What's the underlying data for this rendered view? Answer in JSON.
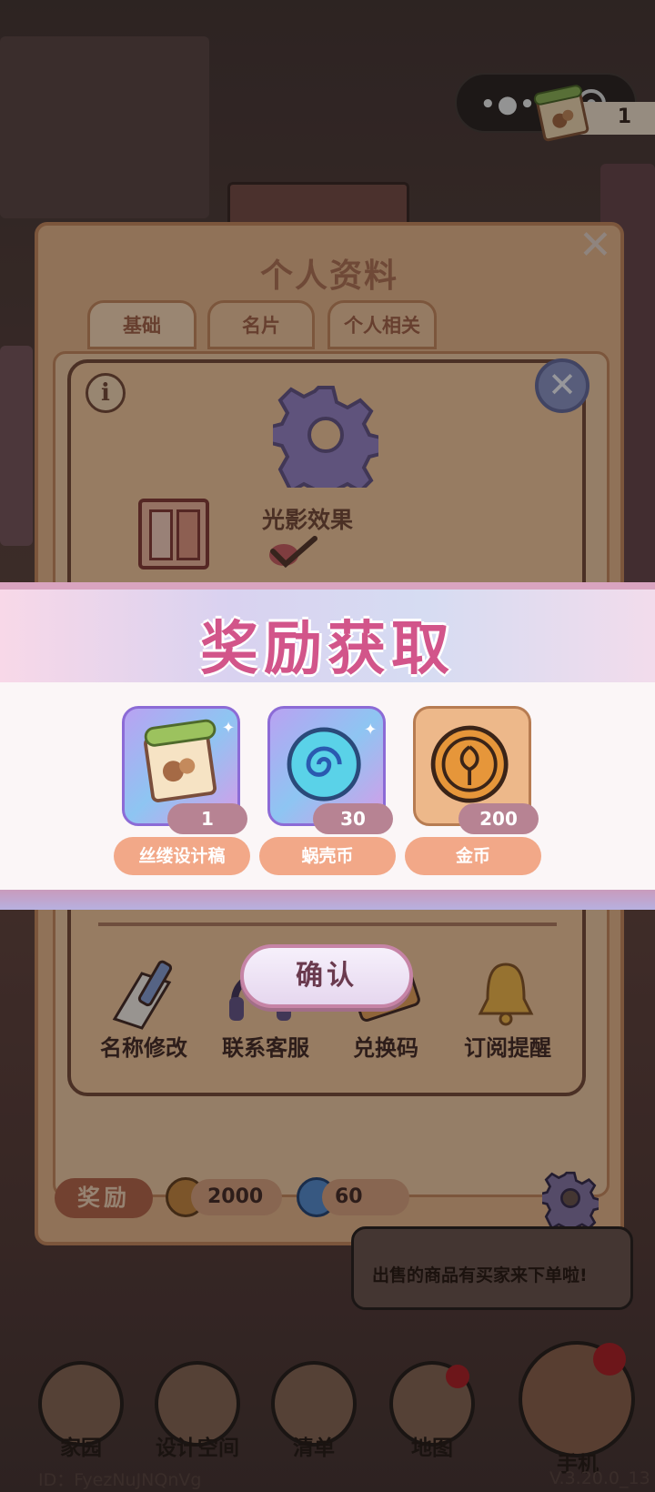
{
  "capsule": {
    "item_count": "1"
  },
  "profile": {
    "title": "个人资料",
    "tabs": [
      "基础",
      "名片",
      "个人相关"
    ]
  },
  "settings": {
    "info_glyph": "i",
    "close_glyph": "✕",
    "light_effect_label": "光影效果",
    "light_effect_enabled": true,
    "features": [
      "名称修改",
      "联系客服",
      "兑换码",
      "订阅提醒"
    ],
    "panel_close_glyph": "✕"
  },
  "rewards_bar": {
    "label": "奖励",
    "coins": "2000",
    "snail_coins": "60"
  },
  "toast": {
    "message": "出售的商品有买家来下单啦!"
  },
  "bottom_nav": {
    "items": [
      "家园",
      "设计空间",
      "清单",
      "地图",
      "手机"
    ]
  },
  "footer": {
    "user_id": "ID：FyezNuJNQnVg",
    "version": "V.3.20.0_13"
  },
  "reward_dialog": {
    "title": "奖励获取",
    "items": [
      {
        "name": "丝缕设计稿",
        "count": "1",
        "icon": "scroll-icon"
      },
      {
        "name": "蜗壳币",
        "count": "30",
        "icon": "snail-coin-icon"
      },
      {
        "name": "金币",
        "count": "200",
        "icon": "gold-coin-icon"
      }
    ],
    "confirm_label": "确认"
  },
  "colors": {
    "title_pink": "#d2558a",
    "label_bg": "#f2a888",
    "count_bg": "#b78393",
    "panel": "#f4c99e"
  }
}
